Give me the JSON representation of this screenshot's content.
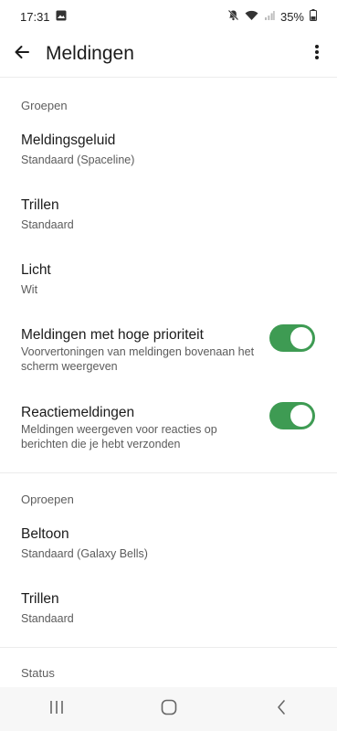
{
  "status_bar": {
    "time": "17:31",
    "battery": "35%"
  },
  "app_bar": {
    "title": "Meldingen"
  },
  "sections": {
    "groups": {
      "header": "Groepen",
      "items": [
        {
          "title": "Meldingsgeluid",
          "subtitle": "Standaard (Spaceline)"
        },
        {
          "title": "Trillen",
          "subtitle": "Standaard"
        },
        {
          "title": "Licht",
          "subtitle": "Wit"
        },
        {
          "title": "Meldingen met hoge prioriteit",
          "subtitle": "Voorvertoningen van meldingen bovenaan het scherm weergeven",
          "toggle": true
        },
        {
          "title": "Reactiemeldingen",
          "subtitle": "Meldingen weergeven voor reacties op berichten die je hebt verzonden",
          "toggle": true
        }
      ]
    },
    "calls": {
      "header": "Oproepen",
      "items": [
        {
          "title": "Beltoon",
          "subtitle": "Standaard (Galaxy Bells)"
        },
        {
          "title": "Trillen",
          "subtitle": "Standaard"
        }
      ]
    },
    "status": {
      "header": "Status"
    }
  },
  "colors": {
    "toggle_on": "#3e9b53",
    "nav_background": "#f7f7f7"
  },
  "icons": [
    "image-icon",
    "mute-icon",
    "wifi-icon",
    "signal-icon",
    "battery-icon",
    "back-arrow-icon",
    "more-vert-icon",
    "recents-icon",
    "home-icon",
    "back-nav-icon"
  ]
}
